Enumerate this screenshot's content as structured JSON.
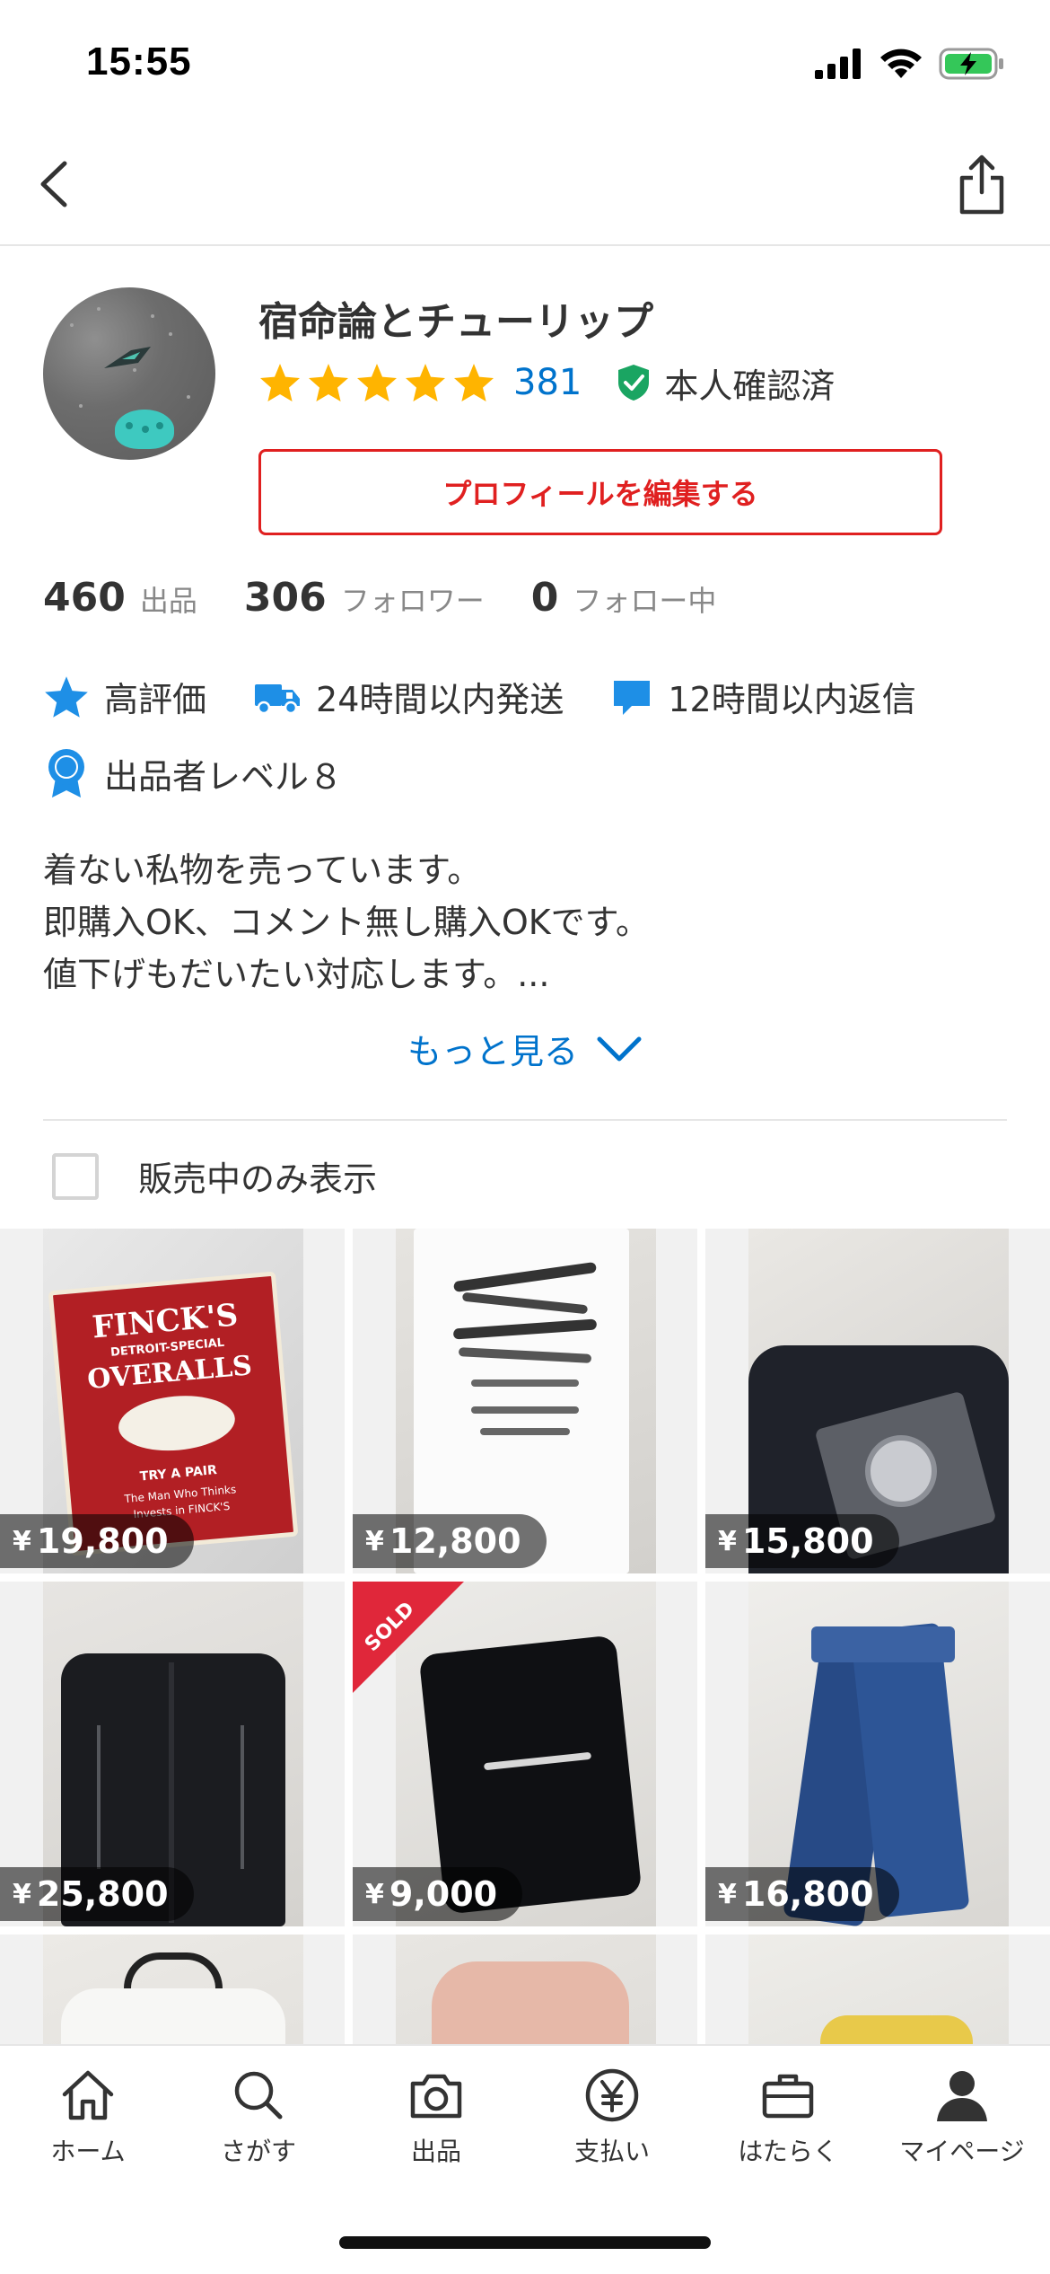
{
  "status_bar": {
    "time": "15:55",
    "icons": [
      "signal-icon",
      "wifi-icon",
      "battery-charging-icon"
    ]
  },
  "header": {
    "back_icon": "chevron-left-icon",
    "share_icon": "share-icon"
  },
  "profile": {
    "name": "宿命論とチューリップ",
    "rating_stars": 5,
    "rating_count": "381",
    "verified_label": "本人確認済",
    "edit_button": "プロフィールを編集する"
  },
  "stats": [
    {
      "value": "460",
      "label": "出品"
    },
    {
      "value": "306",
      "label": "フォロワー"
    },
    {
      "value": "0",
      "label": "フォロー中"
    }
  ],
  "badges": [
    {
      "icon": "star-icon",
      "label": "高評価"
    },
    {
      "icon": "truck-icon",
      "label": "24時間以内発送"
    },
    {
      "icon": "chat-bubble-icon",
      "label": "12時間以内返信"
    },
    {
      "icon": "medal-icon",
      "label": "出品者レベル８"
    }
  ],
  "bio": {
    "lines": [
      "着ない私物を売っています。",
      "即購入OK、コメント無し購入OKです。",
      "値下げもだいたい対応します。..."
    ],
    "more": "もっと見る"
  },
  "filter": {
    "label": "販売中のみ表示",
    "checked": false
  },
  "items": [
    {
      "price": "19,800",
      "sold": false,
      "desc": "FINCK'S overalls tin sign"
    },
    {
      "price": "12,800",
      "sold": false,
      "desc": "white graphic t-shirt"
    },
    {
      "price": "15,800",
      "sold": false,
      "desc": "black watch print t-shirt"
    },
    {
      "price": "25,800",
      "sold": false,
      "desc": "black guayabera shirt"
    },
    {
      "price": "9,000",
      "sold": true,
      "desc": "black Alderwood Mall t-shirt"
    },
    {
      "price": "16,800",
      "sold": false,
      "desc": "blue flared jeans"
    }
  ],
  "yen_symbol": "¥",
  "sold_label": "SOLD",
  "tabs": [
    {
      "icon": "home-icon",
      "label": "ホーム"
    },
    {
      "icon": "search-icon",
      "label": "さがす"
    },
    {
      "icon": "camera-icon",
      "label": "出品"
    },
    {
      "icon": "yen-circle-icon",
      "label": "支払い"
    },
    {
      "icon": "briefcase-icon",
      "label": "はたらく"
    },
    {
      "icon": "person-icon",
      "label": "マイページ"
    }
  ],
  "colors": {
    "accent_red": "#e02020",
    "link_blue": "#0073cc",
    "star_yellow": "#ffb400",
    "badge_blue": "#1e8fe6",
    "verified_green": "#1aa562"
  }
}
